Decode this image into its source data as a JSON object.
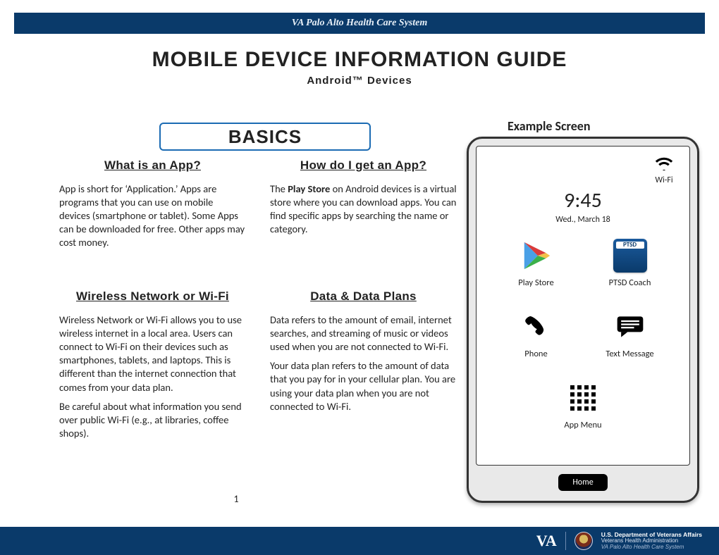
{
  "header": {
    "org": "VA Palo Alto Health Care System"
  },
  "title": "MOBILE DEVICE INFORMATION GUIDE",
  "subtitle": "Android™ Devices",
  "basics_label": "BASICS",
  "sections": {
    "what_app": {
      "heading": "What is an App?",
      "body": "App is short for ‘Application.’ Apps are programs that you can use on mobile devices (smartphone or tablet). Some Apps can be downloaded for free. Other apps may cost money."
    },
    "get_app": {
      "heading": "How do I get an App?",
      "body_pre": "The ",
      "body_bold": "Play Store",
      "body_post": " on Android devices is a virtual store where you can download apps. You can find specific apps by searching the name or category."
    },
    "wifi": {
      "heading": "Wireless Network or Wi-Fi",
      "p1": "Wireless Network or Wi-Fi allows you to use wireless internet in a local area. Users can connect to Wi-Fi on their devices such as smartphones, tablets, and laptops. This is different than the internet connection that comes from your data plan.",
      "p2": "Be careful about what information you send over public Wi-Fi (e.g., at libraries, coffee shops)."
    },
    "data": {
      "heading": "Data & Data Plans",
      "p1": "Data refers to the amount of email, internet searches, and streaming of music or videos used when you are not connected to Wi-Fi.",
      "p2": "Your data plan refers to the amount of data that you pay for in your cellular plan. You are using your data plan when you are not connected to Wi-Fi."
    }
  },
  "page_number": "1",
  "example_label": "Example Screen",
  "phone": {
    "wifi_label": "Wi-Fi",
    "time": "9:45",
    "date": "Wed., March 18",
    "apps": {
      "playstore": "Play Store",
      "ptsd": "PTSD Coach",
      "phone": "Phone",
      "text": "Text Message",
      "menu": "App Menu"
    },
    "home": "Home"
  },
  "footer": {
    "va": "VA",
    "l1": "U.S. Department of Veterans Affairs",
    "l2": "Veterans Health Administration",
    "l3": "VA Palo Alto Health Care System"
  }
}
